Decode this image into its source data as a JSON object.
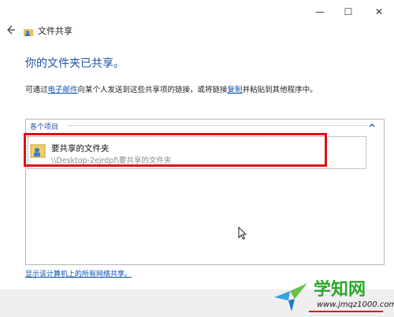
{
  "window": {
    "title": "文件共享",
    "controls": {
      "minimize": "—",
      "maximize": "☐",
      "close": "✕"
    }
  },
  "main": {
    "heading": "你的文件夹已共享。",
    "description_parts": [
      "可通过",
      "电子邮件",
      "向某个人发送到这些共享项的链接，或将链接",
      "复制",
      "并粘贴到其他程序中。"
    ]
  },
  "list": {
    "group_label": "各个项目",
    "items": [
      {
        "name": "要共享的文件夹",
        "path": "\\\\Desktop-2ejrdpf\\要共享的文件夹"
      }
    ]
  },
  "footer_link": "显示该计算机上的所有网络共享。",
  "watermark": {
    "title": "学知网",
    "url": "www.jmqz1000.com"
  },
  "colors": {
    "heading": "#1f4fa3",
    "link": "#0b50b0",
    "highlight": "#e01010",
    "watermark": "#2aa82a"
  }
}
